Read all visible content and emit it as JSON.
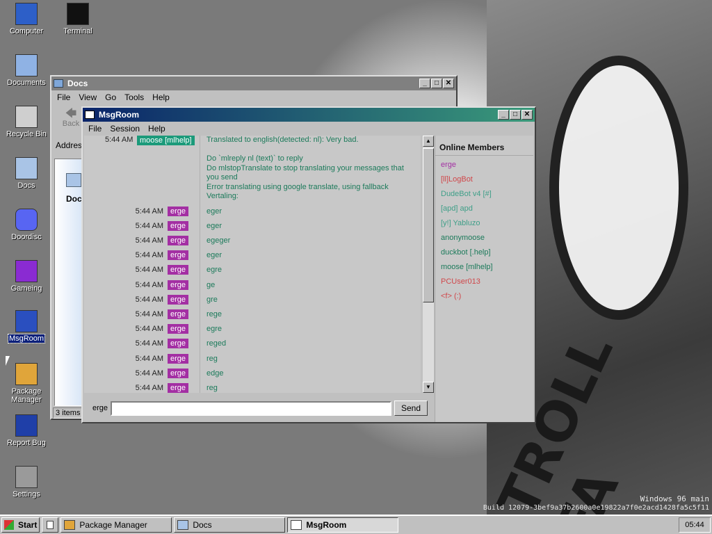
{
  "desktop": {
    "icons": [
      {
        "label": "Computer",
        "icon": "computer-icon"
      },
      {
        "label": "Terminal",
        "icon": "terminal-icon"
      },
      {
        "label": "Documents",
        "icon": "documents-icon"
      },
      {
        "label": "Recycle Bin",
        "icon": "recycle-bin-icon"
      },
      {
        "label": "Docs",
        "icon": "folder-icon"
      },
      {
        "label": "Doordisc",
        "icon": "doordisc-icon"
      },
      {
        "label": "Gameing",
        "icon": "game-cube-icon"
      },
      {
        "label": "MsgRoom",
        "icon": "msgroom-icon"
      },
      {
        "label": "Package\nManager",
        "icon": "package-icon"
      },
      {
        "label": "Report Bug",
        "icon": "report-bug-icon"
      },
      {
        "label": "Settings",
        "icon": "settings-icon"
      }
    ],
    "wallpaper_text": "TROLL FA",
    "watermark": [
      "Windows 96 main",
      "Build 12079-3bef9a37b2600a0e19822a7f0e2acd1428fa5c5f11"
    ]
  },
  "docs_window": {
    "title": "Docs",
    "menu": [
      "File",
      "View",
      "Go",
      "Tools",
      "Help"
    ],
    "back_label": "Back",
    "address_label": "Addres",
    "folder_label": "Docs",
    "status": "3 items"
  },
  "msgroom": {
    "title": "MsgRoom",
    "menu": [
      "File",
      "Session",
      "Help"
    ],
    "top_message": {
      "time": "5:44 AM",
      "nick": "moose [mlhelp]",
      "lines": [
        "Translated to english(detected: nl): Very bad.",
        "",
        "Do `mlreply nl (text)` to reply",
        "Do mlstopTranslate to stop translating your messages that",
        "you send",
        "Error translating using google translate, using fallback",
        "Vertaling:"
      ]
    },
    "messages": [
      {
        "time": "5:44 AM",
        "nick": "erge",
        "text": "eger"
      },
      {
        "time": "5:44 AM",
        "nick": "erge",
        "text": "eger"
      },
      {
        "time": "5:44 AM",
        "nick": "erge",
        "text": "egeger"
      },
      {
        "time": "5:44 AM",
        "nick": "erge",
        "text": "eger"
      },
      {
        "time": "5:44 AM",
        "nick": "erge",
        "text": "egre"
      },
      {
        "time": "5:44 AM",
        "nick": "erge",
        "text": "ge"
      },
      {
        "time": "5:44 AM",
        "nick": "erge",
        "text": "gre"
      },
      {
        "time": "5:44 AM",
        "nick": "erge",
        "text": "rege"
      },
      {
        "time": "5:44 AM",
        "nick": "erge",
        "text": "egre"
      },
      {
        "time": "5:44 AM",
        "nick": "erge",
        "text": "reged"
      },
      {
        "time": "5:44 AM",
        "nick": "erge",
        "text": "reg"
      },
      {
        "time": "5:44 AM",
        "nick": "erge",
        "text": "edge"
      },
      {
        "time": "5:44 AM",
        "nick": "erge",
        "text": "reg"
      }
    ],
    "members_title": "Online Members",
    "members": [
      {
        "name": "erge",
        "color": "#a32fa3"
      },
      {
        "name": "[ll]LogBot",
        "color": "#d0474a"
      },
      {
        "name": "DudeBot v4 [#]",
        "color": "#3f9f88"
      },
      {
        "name": "[apd] apd",
        "color": "#3f9f88"
      },
      {
        "name": "[y!] Yabluzo",
        "color": "#3f9f88"
      },
      {
        "name": "anonymoose",
        "color": "#1b7a5a"
      },
      {
        "name": "duckbot [.help]",
        "color": "#1b7a5a"
      },
      {
        "name": "moose [mlhelp]",
        "color": "#1b7a5a"
      },
      {
        "name": "PCUser013",
        "color": "#d0474a"
      },
      {
        "name": "<f> (:)",
        "color": "#d0474a"
      }
    ],
    "input_user": "erge",
    "input_value": "",
    "send_label": "Send"
  },
  "taskbar": {
    "start_label": "Start",
    "items": [
      {
        "label": "Package Manager",
        "active": false
      },
      {
        "label": "Docs",
        "active": false
      },
      {
        "label": "MsgRoom",
        "active": true
      }
    ],
    "clock": "05:44"
  },
  "colors": {
    "titlebar_start": "#0a246a",
    "titlebar_end": "#3a9a7a",
    "nick_bg": "#a32fa3",
    "message_text": "#1b7a5a"
  }
}
